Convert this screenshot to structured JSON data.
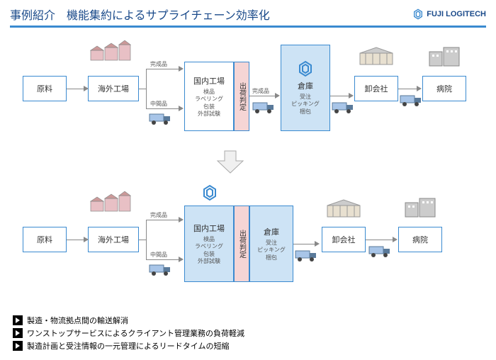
{
  "header": {
    "title": "事例紹介　機能集約によるサプライチェーン効率化",
    "brand": "FUJI LOGITECH"
  },
  "flow1": {
    "raw": "原料",
    "overseas": "海外工場",
    "finished": "完成品",
    "intermediate": "中間品",
    "domestic": "国内工場",
    "domestic_sub": "検品\nラベリング\n包装\n外部試験",
    "judge": "出荷判定",
    "finished2": "完成品",
    "warehouse": "倉庫",
    "warehouse_sub": "受注\nピッキング\n梱包",
    "wholesaler": "卸会社",
    "hospital": "病院"
  },
  "flow2": {
    "raw": "原料",
    "overseas": "海外工場",
    "finished": "完成品",
    "intermediate": "中間品",
    "domestic": "国内工場",
    "domestic_sub": "検品\nラベリング\n包装\n外部試験",
    "judge": "出荷判定",
    "warehouse": "倉庫",
    "warehouse_sub": "受注\nピッキング\n梱包",
    "wholesaler": "卸会社",
    "hospital": "病院"
  },
  "bullets": [
    "製造・物流拠点間の輸送解消",
    "ワンストップサービスによるクライアント管理業務の負荷軽減",
    "製造計画と受注情報の一元管理によるリードタイムの短縮"
  ]
}
